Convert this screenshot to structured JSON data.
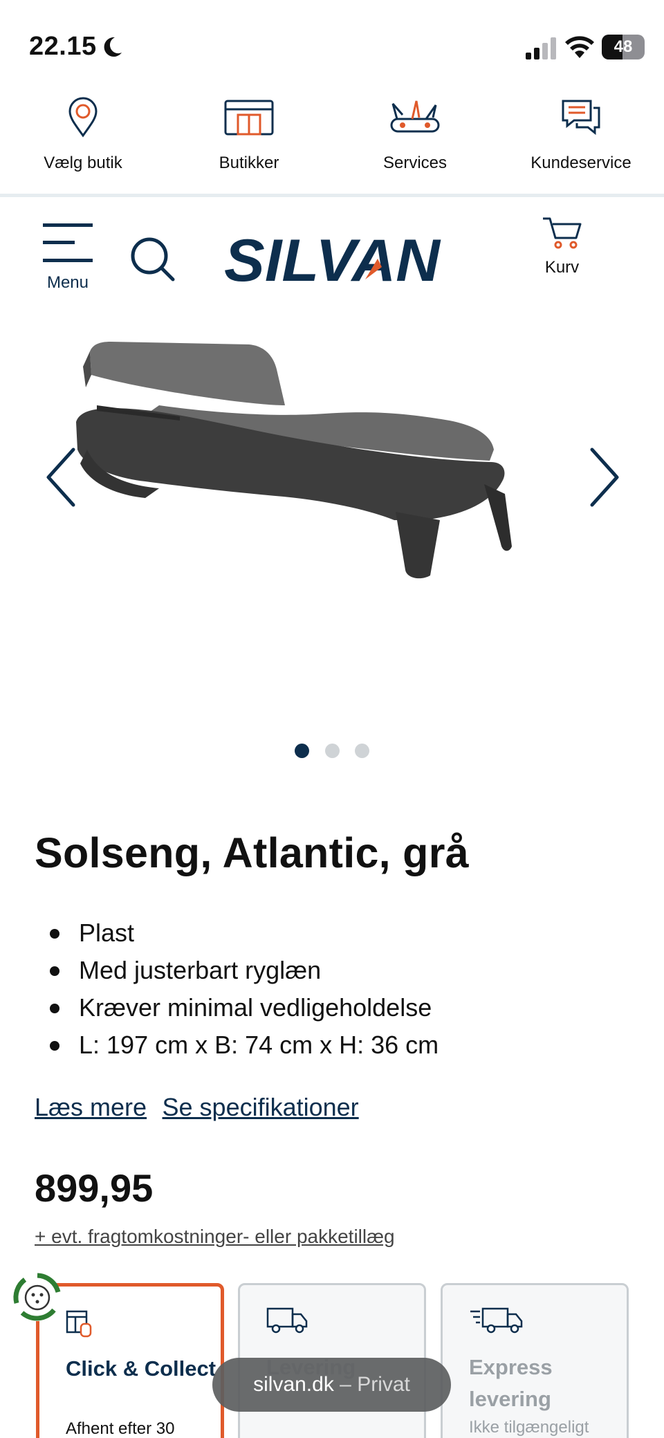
{
  "status_bar": {
    "time": "22.15",
    "battery": "48"
  },
  "utility_nav": [
    {
      "label": "Vælg butik",
      "icon": "location-pin-icon"
    },
    {
      "label": "Butikker",
      "icon": "store-icon"
    },
    {
      "label": "Services",
      "icon": "multitool-icon"
    },
    {
      "label": "Kundeservice",
      "icon": "chat-bubbles-icon"
    }
  ],
  "header": {
    "menu_label": "Menu",
    "logo_text": "SILVAN",
    "cart_label": "Kurv"
  },
  "gallery": {
    "slide_count": 3,
    "active_slide": 1
  },
  "product": {
    "title": "Solseng, Atlantic, grå",
    "features": [
      "Plast",
      "Med justerbart ryglæn",
      "Kræver minimal vedligeholdelse",
      "L: 197 cm x B: 74 cm x H: 36 cm"
    ],
    "read_more": "Læs mere",
    "specifications": "Se specifikationer",
    "price": "899,95",
    "freight_note": "+ evt. fragtomkostninger- eller pakketillæg"
  },
  "delivery_options": {
    "click_collect": {
      "title": "Click & Collect",
      "subtitle": "Afhent efter 30"
    },
    "delivery": {
      "title": "Levering"
    },
    "express": {
      "title": "Express levering",
      "subtitle": "Ikke tilgængeligt"
    }
  },
  "browser": {
    "domain": "silvan.dk",
    "separator": "–",
    "mode": "Privat"
  },
  "colors": {
    "brand_navy": "#0d2e4d",
    "brand_orange": "#e05a2b",
    "eco_green": "#2e7d32"
  }
}
